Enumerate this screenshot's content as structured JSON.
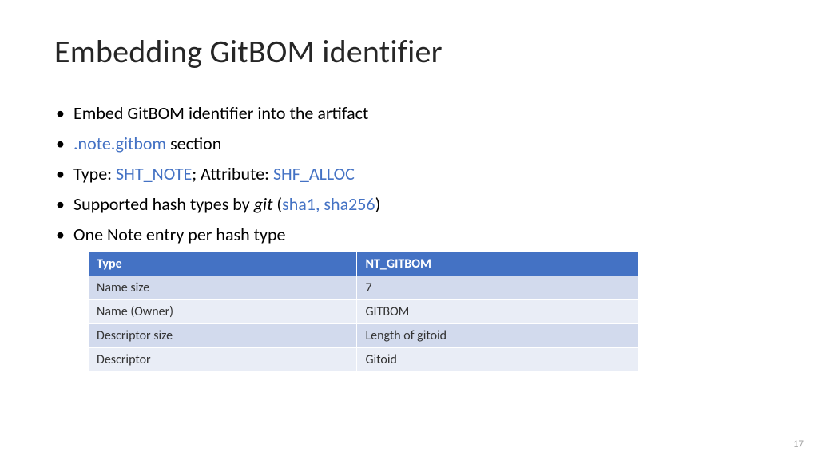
{
  "title": "Embedding GitBOM identifier",
  "bullets": [
    {
      "pre": "Embed GitBOM identifier into the artifact"
    },
    {
      "link1": ".note.gitbom",
      "post1": " section"
    },
    {
      "pre": "Type: ",
      "link1": "SHT_NOTE",
      "mid1": "; Attribute: ",
      "link2": "SHF_ALLOC"
    },
    {
      "pre": "Supported hash types by ",
      "ital": "git",
      "mid1": " (",
      "link1": "sha1, sha256",
      "post1": ")"
    },
    {
      "pre": "One Note entry per hash type"
    }
  ],
  "table": {
    "header": {
      "c0": "Type",
      "c1": "NT_GITBOM"
    },
    "rows": [
      {
        "c0": "Name size",
        "c1": "7"
      },
      {
        "c0": "Name (Owner)",
        "c1": "GITBOM"
      },
      {
        "c0": "Descriptor size",
        "c1": "Length of gitoid"
      },
      {
        "c0": "Descriptor",
        "c1": "Gitoid"
      }
    ]
  },
  "pagenum": "17"
}
